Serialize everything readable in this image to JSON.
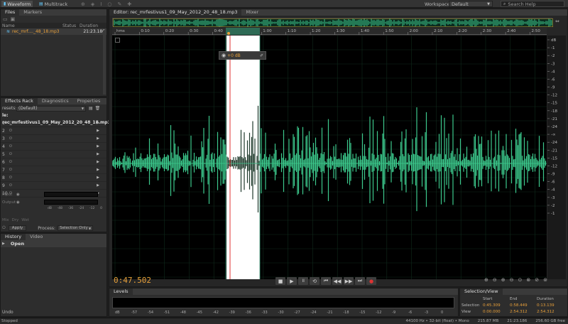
{
  "topbar": {
    "waveform_label": "Waveform",
    "multitrack_label": "Multitrack",
    "workspace_label": "Workspace:",
    "workspace_value": "Default",
    "search_placeholder": "Search Help"
  },
  "files_panel": {
    "tabs": [
      "Files",
      "Markers"
    ],
    "col_name": "Name",
    "col_status": "Status",
    "col_duration": "Duration",
    "file_name": "rec_mrf...._48_18.mp3",
    "file_duration": "21:23.186"
  },
  "effects_panel": {
    "tabs": [
      "Effects Rack",
      "Diagnostics",
      "Properties"
    ],
    "presets_label": "resets:",
    "presets_value": "(Default)",
    "file_label": "le: rec_mrfestivus1_09_May_2012_20_48_18.mp3",
    "slots": [
      "1",
      "2",
      "3",
      "4",
      "5",
      "6",
      "7",
      "8",
      "9",
      "10"
    ],
    "input_label": "Input",
    "output_label": "Output",
    "mix_label": "Mix",
    "dry_label": "Dry",
    "wet_label": "Wet",
    "apply_label": "Apply",
    "process_label": "Process:",
    "process_value": "Selection Only",
    "meter_ticks": [
      "dB",
      "-48",
      "-36",
      "-24",
      "-12",
      "0"
    ]
  },
  "history_panel": {
    "tabs": [
      "History",
      "Video"
    ],
    "item": "Open",
    "undo": "Undo"
  },
  "editor": {
    "tabs": [
      "Editor: rec_mrfestivus1_09_May_2012_20_48_18.mp3",
      "Mixer"
    ],
    "ruler_ticks": [
      "hms",
      "0:10",
      "0:20",
      "0:30",
      "0:40",
      "0:50",
      "1:00",
      "1:10",
      "1:20",
      "1:30",
      "1:40",
      "1:50",
      "2:00",
      "2:10",
      "2:20",
      "2:30",
      "2:40",
      "2:50"
    ],
    "db_ticks": [
      "dB",
      "-1",
      "-2",
      "-3",
      "-4",
      "-6",
      "-9",
      "-12",
      "-15",
      "-18",
      "-21",
      "-24",
      "-∞",
      "-24",
      "-21",
      "-15",
      "-12",
      "-9",
      "-6",
      "-4",
      "-3",
      "-2",
      "-1"
    ],
    "hud_value": "+0 dB",
    "time_display": "0:47.502"
  },
  "levels": {
    "title": "Levels",
    "ticks": [
      "dB",
      "-57",
      "-54",
      "-51",
      "-48",
      "-45",
      "-42",
      "-39",
      "-36",
      "-33",
      "-30",
      "-27",
      "-24",
      "-21",
      "-18",
      "-15",
      "-12",
      "-9",
      "-6",
      "-3",
      "0"
    ]
  },
  "selection_view": {
    "title": "Selection/View",
    "col_start": "Start",
    "col_end": "End",
    "col_duration": "Duration",
    "selection_label": "Selection",
    "view_label": "View",
    "selection_start": "0:45.309",
    "selection_end": "0:58.449",
    "selection_duration": "0:13.139",
    "view_start": "0:00.000",
    "view_end": "2:54.312",
    "view_duration": "2:54.312"
  },
  "statusbar": {
    "left": "Stopped",
    "format": "44100 Hz • 32-bit (float) • Mono",
    "size": "215.87 MB",
    "duration": "21:23.186",
    "free": "256.60 GB free"
  },
  "colors": {
    "wave": "#3cc88c",
    "selection": "#ffffff",
    "accent": "#e8a03a"
  }
}
